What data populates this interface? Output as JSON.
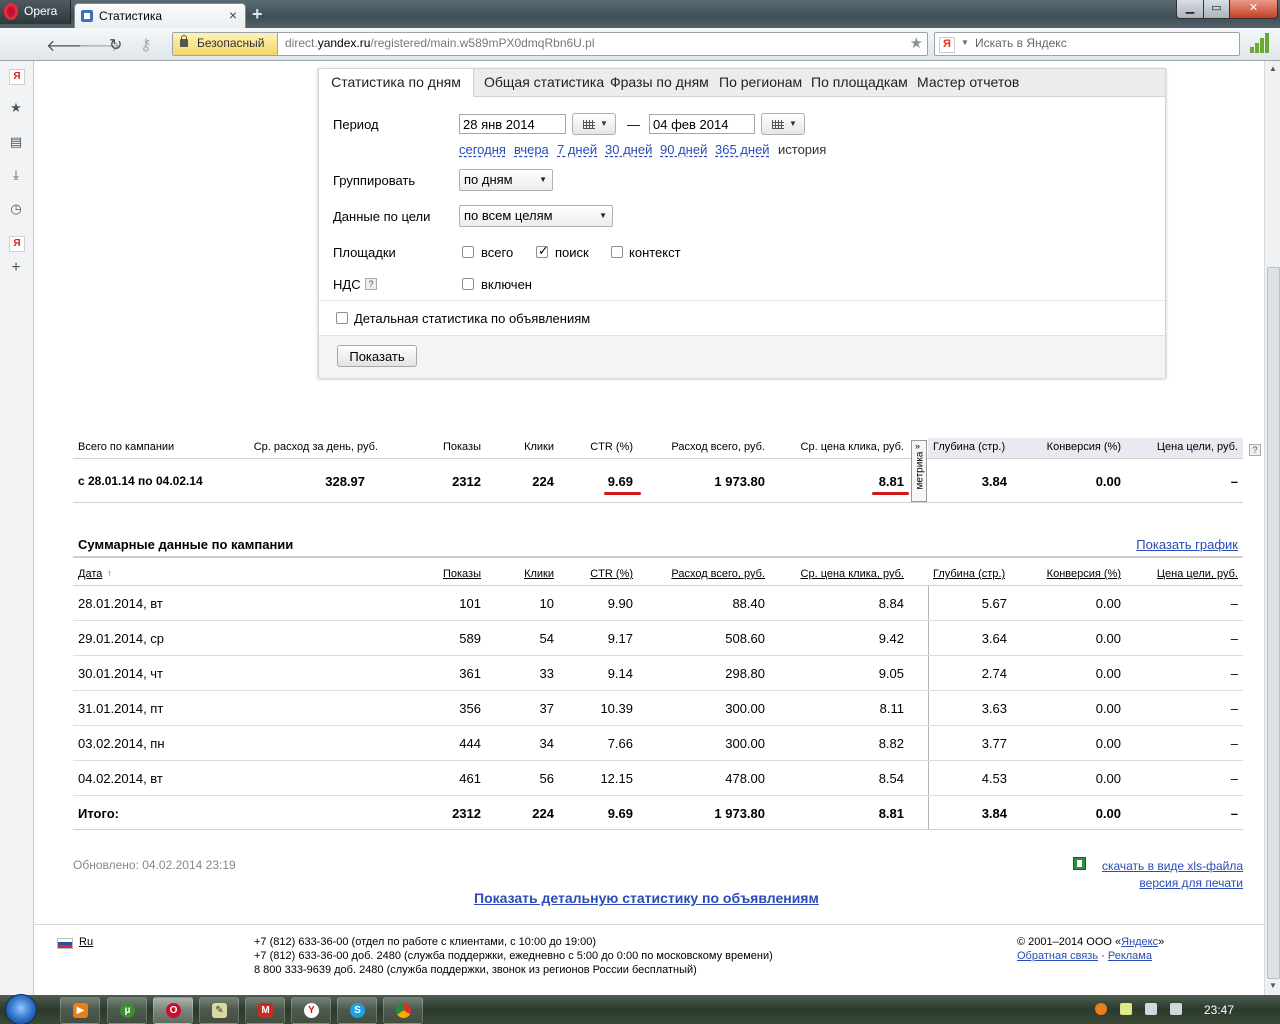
{
  "browser": {
    "menu_label": "Opera",
    "tab_title": "Статистика",
    "tab_close": "×",
    "new_tab": "+",
    "secure_label": "Безопасный",
    "url_pre": "direct.",
    "url_host": "yandex.ru",
    "url_post": "/registered/main.w589mPX0dmqRbn6U.pl",
    "search_placeholder": "Искать в Яндекс",
    "search_engine_glyph": "Я"
  },
  "sidebar_icons": [
    "yandex-icon",
    "bookmarks-star-icon",
    "notes-icon",
    "downloads-icon",
    "history-clock-icon",
    "yandex-icon",
    "add-panel-icon"
  ],
  "stats_tabs": [
    "Статистика по дням",
    "Общая статистика",
    "Фразы по дням",
    "По регионам",
    "По площадкам",
    "Мастер отчетов"
  ],
  "form": {
    "period_label": "Период",
    "date_from": "28 янв 2014",
    "date_dash": "—",
    "date_to": "04 фев 2014",
    "quick_links": [
      "сегодня",
      "вчера",
      "7 дней",
      "30 дней",
      "90 дней",
      "365 дней",
      "история"
    ],
    "group_label": "Группировать",
    "group_value": "по дням",
    "goal_label": "Данные по цели",
    "goal_value": "по всем целям",
    "platforms_label": "Площадки",
    "platform_all": "всего",
    "platform_search": "поиск",
    "platform_context": "контекст",
    "vat_label": "НДС",
    "vat_help": "?",
    "vat_option": "включен",
    "detail_label": "Детальная статистика по объявлениям",
    "show_button": "Показать"
  },
  "summary": {
    "headers": [
      "Всего по кампании",
      "Ср. расход за день, руб.",
      "Показы",
      "Клики",
      "CTR (%)",
      "Расход всего, руб.",
      "Ср. цена клика, руб.",
      "Глубина (стр.)",
      "Конверсия (%)",
      "Цена цели, руб."
    ],
    "help": "?",
    "metrika_label": "метрика",
    "metrika_chevron": "»",
    "row": [
      "с 28.01.14 по 04.02.14",
      "328.97",
      "2312",
      "224",
      "9.69",
      "1 973.80",
      "8.81",
      "3.84",
      "0.00",
      "–"
    ]
  },
  "daily": {
    "title": "Суммарные данные по кампании",
    "graph_link": "Показать график",
    "headers": [
      "Дата",
      "Показы",
      "Клики",
      "CTR (%)",
      "Расход всего, руб.",
      "Ср. цена клика, руб.",
      "Глубина (стр.)",
      "Конверсия (%)",
      "Цена цели, руб."
    ],
    "sort_arrow": "↑",
    "rows": [
      [
        "28.01.2014, вт",
        "101",
        "10",
        "9.90",
        "88.40",
        "8.84",
        "5.67",
        "0.00",
        "–"
      ],
      [
        "29.01.2014, ср",
        "589",
        "54",
        "9.17",
        "508.60",
        "9.42",
        "3.64",
        "0.00",
        "–"
      ],
      [
        "30.01.2014, чт",
        "361",
        "33",
        "9.14",
        "298.80",
        "9.05",
        "2.74",
        "0.00",
        "–"
      ],
      [
        "31.01.2014, пт",
        "356",
        "37",
        "10.39",
        "300.00",
        "8.11",
        "3.63",
        "0.00",
        "–"
      ],
      [
        "03.02.2014, пн",
        "444",
        "34",
        "7.66",
        "300.00",
        "8.82",
        "3.77",
        "0.00",
        "–"
      ],
      [
        "04.02.2014, вт",
        "461",
        "56",
        "12.15",
        "478.00",
        "8.54",
        "4.53",
        "0.00",
        "–"
      ]
    ],
    "total": [
      "Итого:",
      "2312",
      "224",
      "9.69",
      "1 973.80",
      "8.81",
      "3.84",
      "0.00",
      "–"
    ]
  },
  "bottom": {
    "updated": "Обновлено: 04.02.2014 23:19",
    "xls_link": "скачать в виде xls-файла",
    "print_link": "версия для печати",
    "detail_link": "Показать детальную статистику по объявлениям"
  },
  "footer": {
    "lang": "Ru",
    "phone1": "+7 (812) 633-36-00 (отдел по работе с клиентами, с 10:00 до 19:00)",
    "phone2": "+7 (812) 633-36-00 доб. 2480 (служба поддержки, ежедневно с 5:00 до 0:00 по московскому времени)",
    "phone3": "8 800 333-9639 доб. 2480 (служба поддержки, звонок из регионов России бесплатный)",
    "copyright_pre": "© 2001–2014  ООО «",
    "copyright_link": "Яндекс",
    "copyright_post": "»",
    "feedback": "Обратная связь",
    "dot": "·",
    "ads": "Реклама"
  },
  "taskbar": {
    "clock": "23:47"
  },
  "colors": {
    "link": "#2a4bb8",
    "highlight": "#d01818",
    "metrika_band": "#ebe8f0"
  }
}
